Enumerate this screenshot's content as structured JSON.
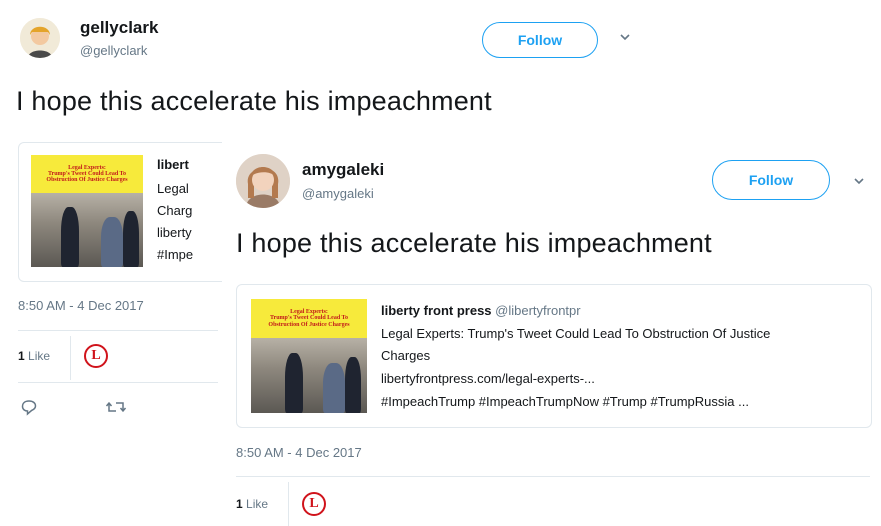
{
  "tweet_back": {
    "user": {
      "name": "gellyclark",
      "handle": "@gellyclark"
    },
    "follow_label": "Follow",
    "text": "I hope this accelerate his impeachment",
    "card": {
      "title": "libert",
      "lines": [
        "Legal",
        "Charg",
        "liberty",
        "#Impe"
      ],
      "thumb_banner": [
        "Legal Experts:",
        "Trump's Tweet Could Lead To",
        "Obstruction Of Justice Charges"
      ]
    },
    "timestamp": "8:50 AM - 4 Dec 2017",
    "likes_count": "1",
    "likes_label": "Like"
  },
  "tweet_front": {
    "user": {
      "name": "amygaleki",
      "handle": "@amygaleki"
    },
    "follow_label": "Follow",
    "text": "I hope this accelerate his impeachment",
    "card": {
      "source_name": "liberty front press",
      "source_handle": "@libertyfrontpr",
      "headline_1": "Legal Experts: Trump's Tweet Could Lead To Obstruction Of Justice",
      "headline_2": "Charges",
      "url": "libertyfrontpress.com/legal-experts-...",
      "hashtags": "#ImpeachTrump #ImpeachTrumpNow #Trump #TrumpRussia ...",
      "thumb_banner": [
        "Legal Experts:",
        "Trump's Tweet Could Lead To",
        "Obstruction Of Justice Charges"
      ]
    },
    "timestamp": "8:50 AM - 4 Dec 2017",
    "likes_count": "1",
    "likes_label": "Like"
  },
  "like_avatar_letter": "L",
  "colors": {
    "follow_blue": "#1da1f2",
    "secondary_text": "#657786",
    "like_avatar_red": "#d0131b"
  },
  "icons": {
    "reply": "reply-icon",
    "retweet": "retweet-icon",
    "chevron": "chevron-down-icon"
  }
}
